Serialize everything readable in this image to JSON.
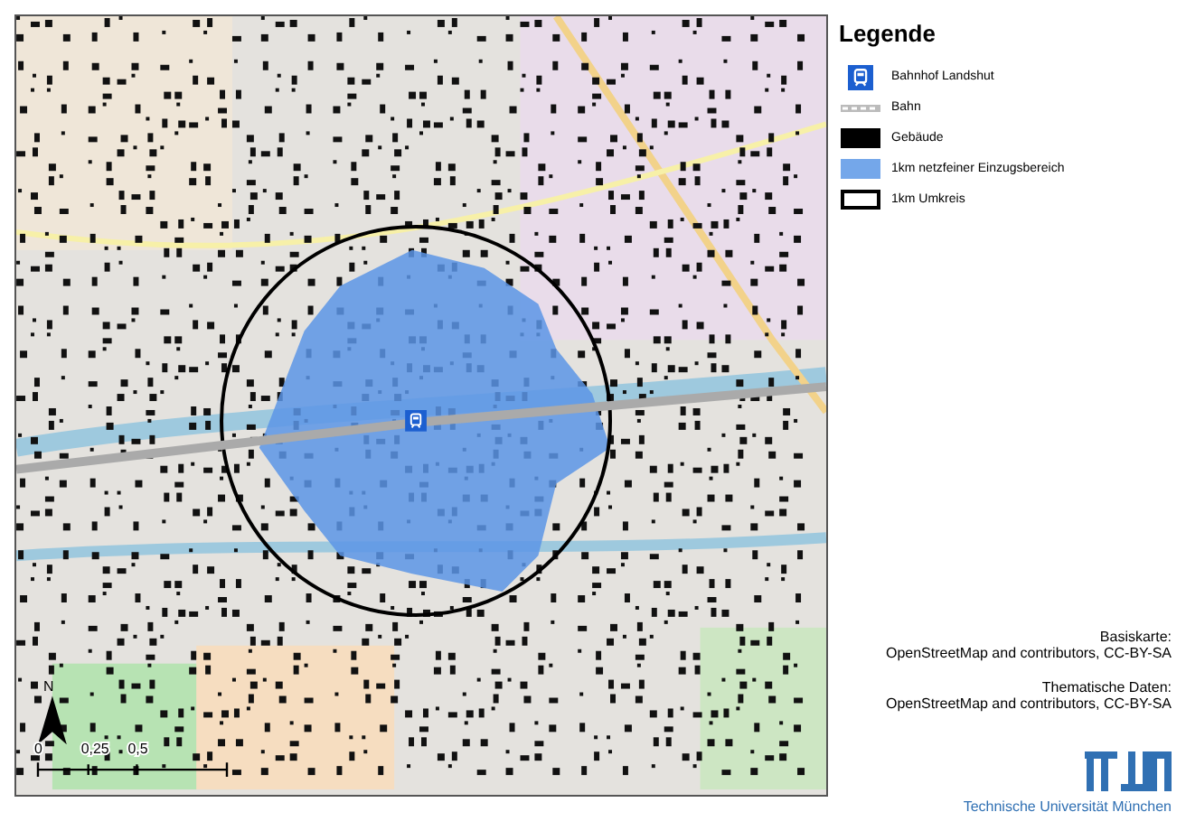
{
  "legend": {
    "title": "Legende",
    "items": [
      {
        "kind": "station",
        "label": "Bahnhof Landshut"
      },
      {
        "kind": "rail",
        "label": "Bahn"
      },
      {
        "kind": "building",
        "label": "Gebäude"
      },
      {
        "kind": "area",
        "label": "1km netzfeiner Einzugsbereich"
      },
      {
        "kind": "circle",
        "label": "1km Umkreis"
      }
    ]
  },
  "map": {
    "north": "N",
    "scale_labels": [
      "0",
      "0,25",
      "0,5"
    ]
  },
  "credits": [
    {
      "heading": "Basiskarte:",
      "text": "OpenStreetMap and contributors, CC-BY-SA"
    },
    {
      "heading": "Thematische Daten:",
      "text": "OpenStreetMap and contributors, CC-BY-SA"
    }
  ],
  "institution": "Technische Universität München"
}
